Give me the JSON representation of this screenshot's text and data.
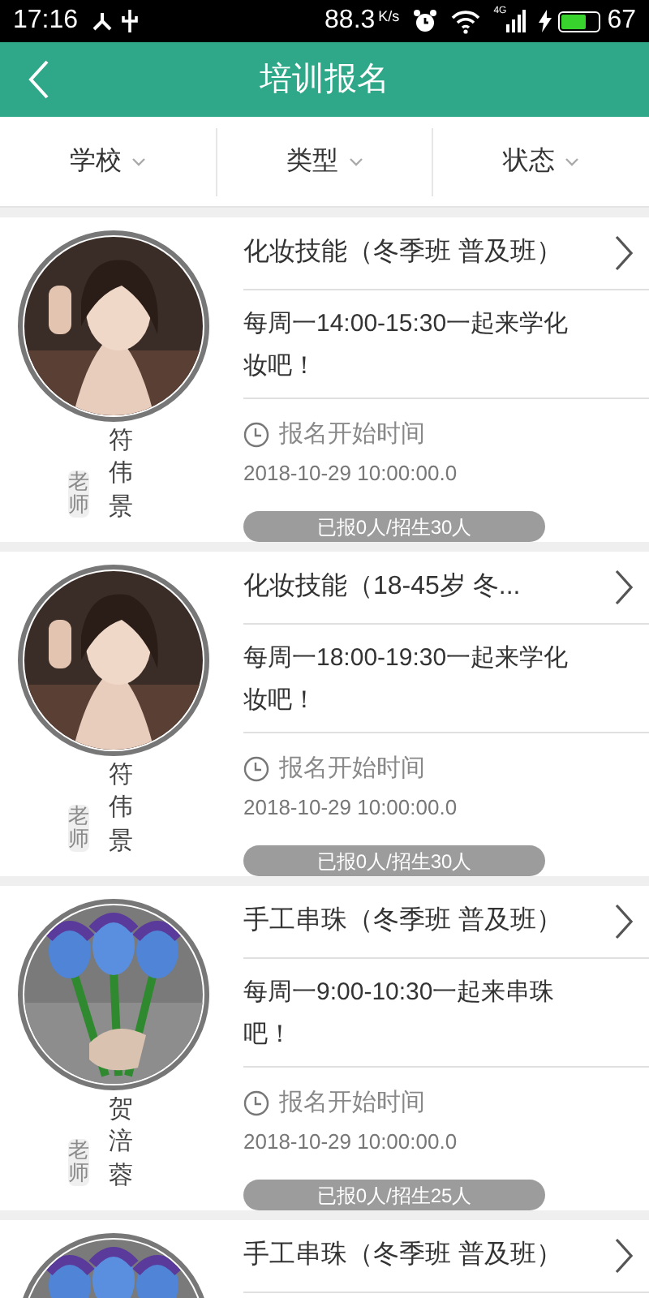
{
  "status_bar": {
    "time": "17:16",
    "speed": "88.3",
    "speed_unit": "K/s",
    "network": "4G",
    "battery": "67"
  },
  "header": {
    "title": "培训报名"
  },
  "filters": [
    {
      "label": "学校"
    },
    {
      "label": "类型"
    },
    {
      "label": "状态"
    }
  ],
  "courses": [
    {
      "title": "化妆技能（冬季班 普及班）",
      "description": "每周一14:00-15:30一起来学化妆吧！",
      "teacher": "符伟景",
      "teacher_badge": "老师",
      "start_label": "报名开始时间",
      "start_time": "2018-10-29 10:00:00.0",
      "enrollment": "已报0人/招生30人"
    },
    {
      "title": "化妆技能（18-45岁 冬...",
      "description": "每周一18:00-19:30一起来学化妆吧！",
      "teacher": "符伟景",
      "teacher_badge": "老师",
      "start_label": "报名开始时间",
      "start_time": "2018-10-29 10:00:00.0",
      "enrollment": "已报0人/招生30人"
    },
    {
      "title": "手工串珠（冬季班 普及班）",
      "description": "每周一9:00-10:30一起来串珠吧！",
      "teacher": "贺涪蓉",
      "teacher_badge": "老师",
      "start_label": "报名开始时间",
      "start_time": "2018-10-29 10:00:00.0",
      "enrollment": "已报0人/招生25人"
    },
    {
      "title": "手工串珠（冬季班 普及班）"
    }
  ]
}
